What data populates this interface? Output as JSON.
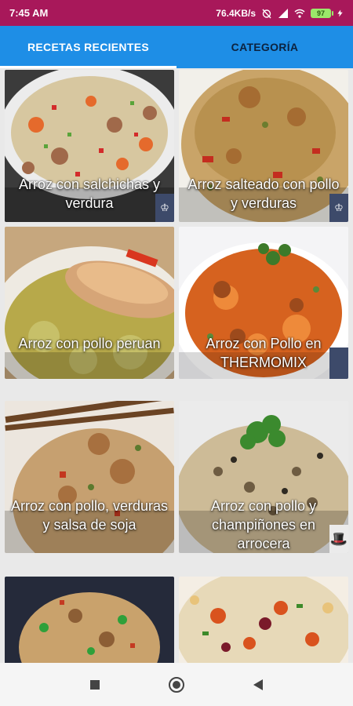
{
  "status": {
    "time": "7:45 AM",
    "speed": "76.4KB/s",
    "battery": "97"
  },
  "tabs": [
    {
      "label": "RECETAS RECIENTES",
      "active": true
    },
    {
      "label": "CATEGORÍA",
      "active": false
    }
  ],
  "recipes": [
    {
      "title": "Arroz con salchichas y verdura"
    },
    {
      "title": "Arroz salteado con pollo y verduras"
    },
    {
      "title": "Arroz con pollo peruan"
    },
    {
      "title": "Arroz con Pollo en THERMOMIX"
    },
    {
      "title": "Arroz con pollo, verduras y salsa de soja"
    },
    {
      "title": "Arroz con pollo y champiñones en arrocera"
    },
    {
      "title": ""
    },
    {
      "title": ""
    }
  ]
}
